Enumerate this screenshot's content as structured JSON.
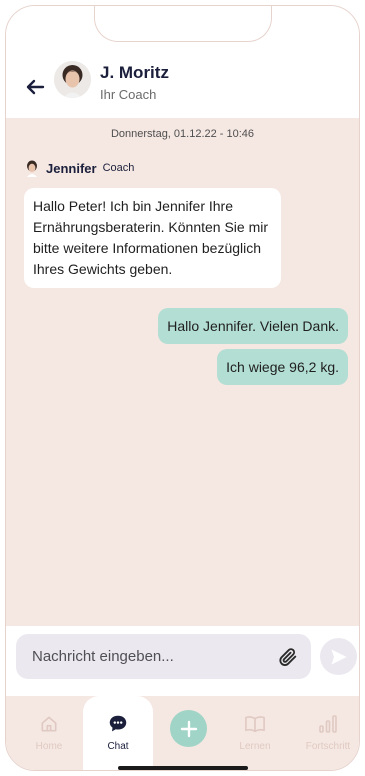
{
  "header": {
    "back_icon": "arrow-left-icon",
    "coach_name": "J. Moritz",
    "coach_subtitle": "Ihr Coach"
  },
  "chat": {
    "date_stamp": "Donnerstag, 01.12.22 - 10:46",
    "sender": {
      "name": "Jennifer",
      "role": "Coach"
    },
    "messages": [
      {
        "direction": "incoming",
        "text": "Hallo Peter! Ich bin Jennifer Ihre Ernährungsberaterin. Könnten Sie mir bitte weitere Informationen bezüglich Ihres Gewichts geben."
      },
      {
        "direction": "outgoing",
        "text": "Hallo Jennifer. Vielen Dank."
      },
      {
        "direction": "outgoing",
        "text": "Ich wiege 96,2 kg."
      }
    ]
  },
  "composer": {
    "placeholder": "Nachricht eingeben...",
    "value": "",
    "attach_icon": "paperclip-icon",
    "send_icon": "send-icon"
  },
  "nav": {
    "items": [
      {
        "label": "Home",
        "icon": "home-icon",
        "active": false
      },
      {
        "label": "Chat",
        "icon": "chat-icon",
        "active": true
      },
      {
        "label": "",
        "icon": "plus-icon",
        "active": false
      },
      {
        "label": "Lernen",
        "icon": "book-icon",
        "active": false
      },
      {
        "label": "Fortschritt",
        "icon": "bar-chart-icon",
        "active": false
      }
    ]
  },
  "colors": {
    "chat_background": "#f5e8e3",
    "outgoing_bubble": "#b3ded3",
    "accent": "#9fd4c6",
    "text_dark": "#1b1f3b"
  }
}
